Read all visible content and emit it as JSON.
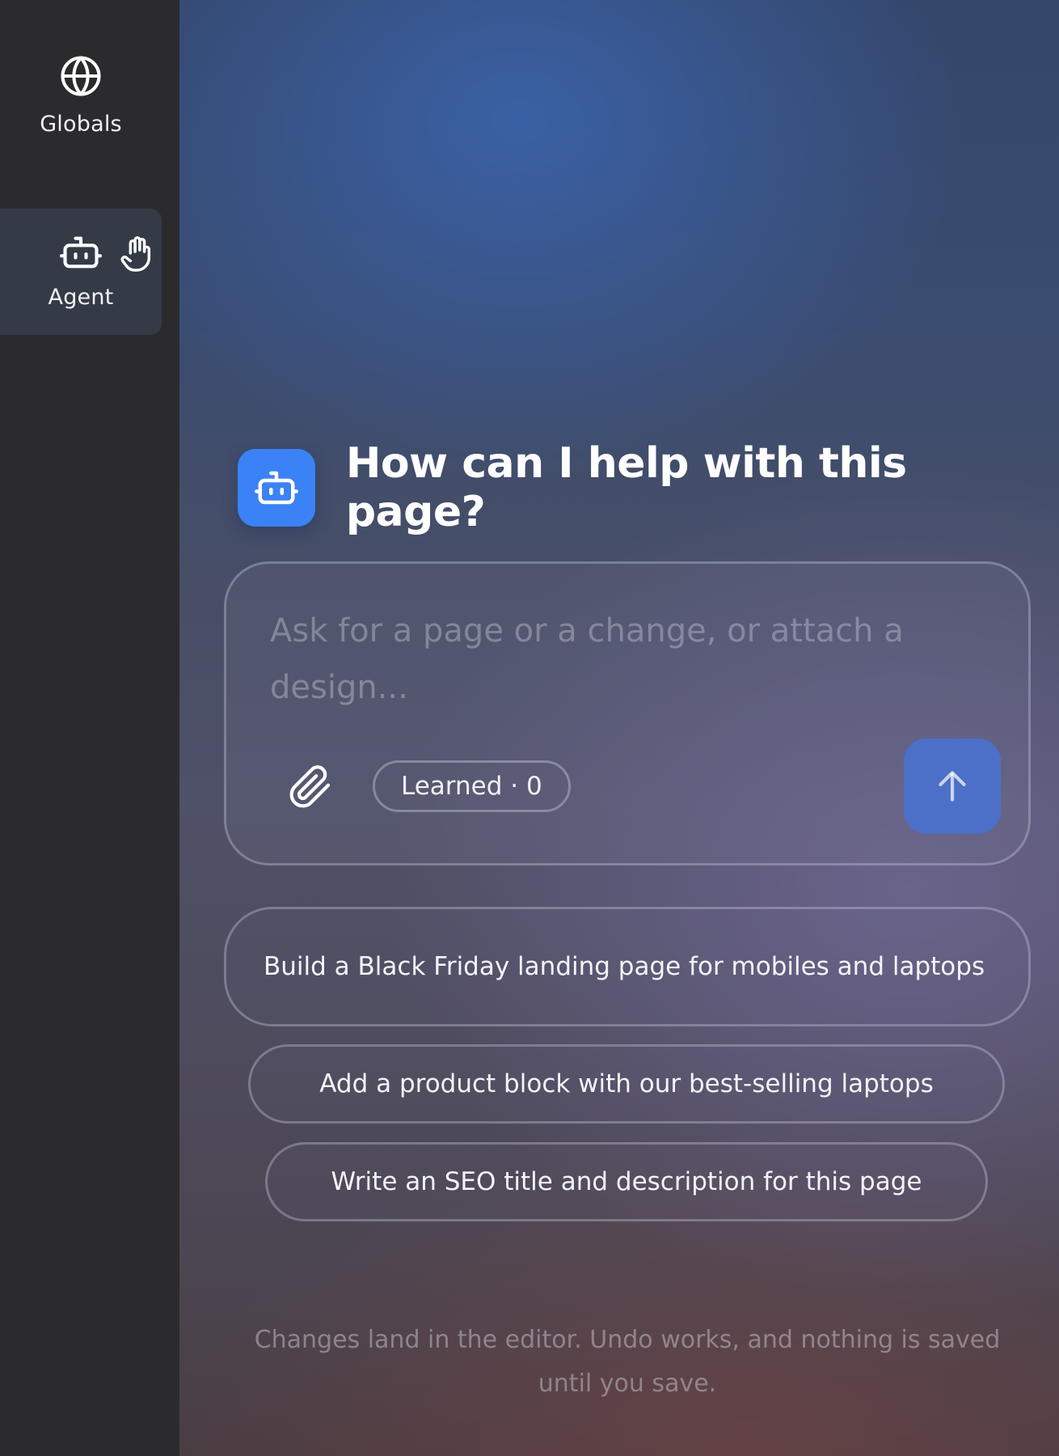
{
  "sidebar": {
    "items": [
      {
        "label": "Globals",
        "icon": "globe-icon"
      },
      {
        "label": "Agent",
        "icon": "robot-icon",
        "secondary_icon": "hand-icon",
        "active": true
      }
    ]
  },
  "main": {
    "title": "How can I help with this page?",
    "composer": {
      "placeholder": "Ask for a page or a change, or attach a design...",
      "value": "",
      "learned_label": "Learned · 0"
    },
    "suggestions": [
      "Build a Black Friday landing page for mobiles and laptops",
      "Add a product block with our best-selling laptops",
      "Write an SEO title and description for this page"
    ],
    "footnote": "Changes land in the editor. Undo works, and nothing is saved until you save."
  },
  "colors": {
    "accent": "#3b82f6",
    "send_button": "#4c70c8",
    "sidebar_bg": "#2b2b2d",
    "active_nav_bg": "#343b47"
  }
}
